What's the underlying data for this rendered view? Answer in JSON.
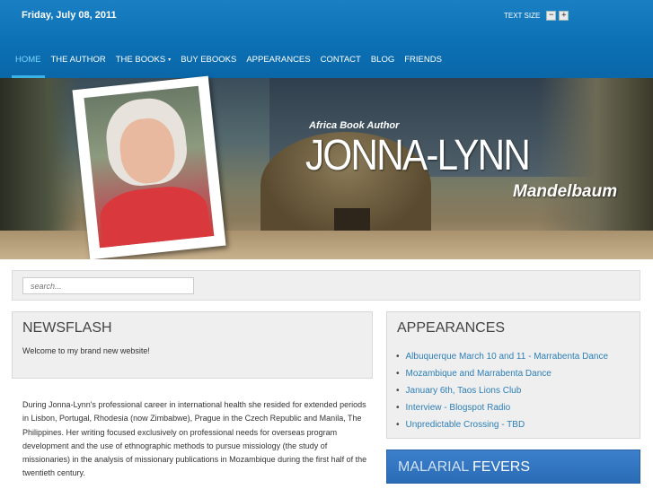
{
  "header": {
    "date": "Friday, July 08, 2011",
    "text_size_label": "TEXT SIZE",
    "text_size_decrease": "−",
    "text_size_increase": "+"
  },
  "nav": {
    "items": [
      {
        "label": "HOME",
        "active": true
      },
      {
        "label": "THE AUTHOR"
      },
      {
        "label": "THE BOOKS",
        "has_dropdown": true
      },
      {
        "label": "BUY EBOOKS"
      },
      {
        "label": "APPEARANCES"
      },
      {
        "label": "CONTACT"
      },
      {
        "label": "BLOG"
      },
      {
        "label": "FRIENDS"
      }
    ],
    "dropdown_icon": "chevron-down-icon"
  },
  "banner": {
    "subtitle": "Africa Book Author",
    "name": "JONNA-LYNN",
    "surname": "Mandelbaum"
  },
  "search": {
    "placeholder": "search..."
  },
  "newsflash": {
    "title": "NEWSFLASH",
    "message": "Welcome to my brand new website!"
  },
  "bio": {
    "text": "During Jonna-Lynn's professional career in international health she resided for extended periods in Lisbon, Portugal, Rhodesia (now Zimbabwe), Prague in the Czech Republic and Manila, The Philippines. Her writing focused exclusively on professional needs for overseas program development and the use of ethnographic methods to pursue missiology (the study of missionaries) in the analysis of missionary publications in Mozambique during the first half of the twentieth century."
  },
  "appearances": {
    "title": "APPEARANCES",
    "items": [
      "Albuquerque March 10 and 11 - Marrabenta Dance",
      "Mozambique and Marrabenta Dance",
      "January 6th, Taos Lions Club",
      "Interview - Blogspot Radio",
      "Unpredictable Crossing - TBD"
    ]
  },
  "malarial": {
    "title_part1": "MALARIAL",
    "title_part2": "FEVERS"
  },
  "colors": {
    "header_blue": "#0b6fb3",
    "nav_active": "#7fd7ff",
    "link_blue": "#2d7fb8",
    "panel_blue": "#2a6cb6"
  }
}
